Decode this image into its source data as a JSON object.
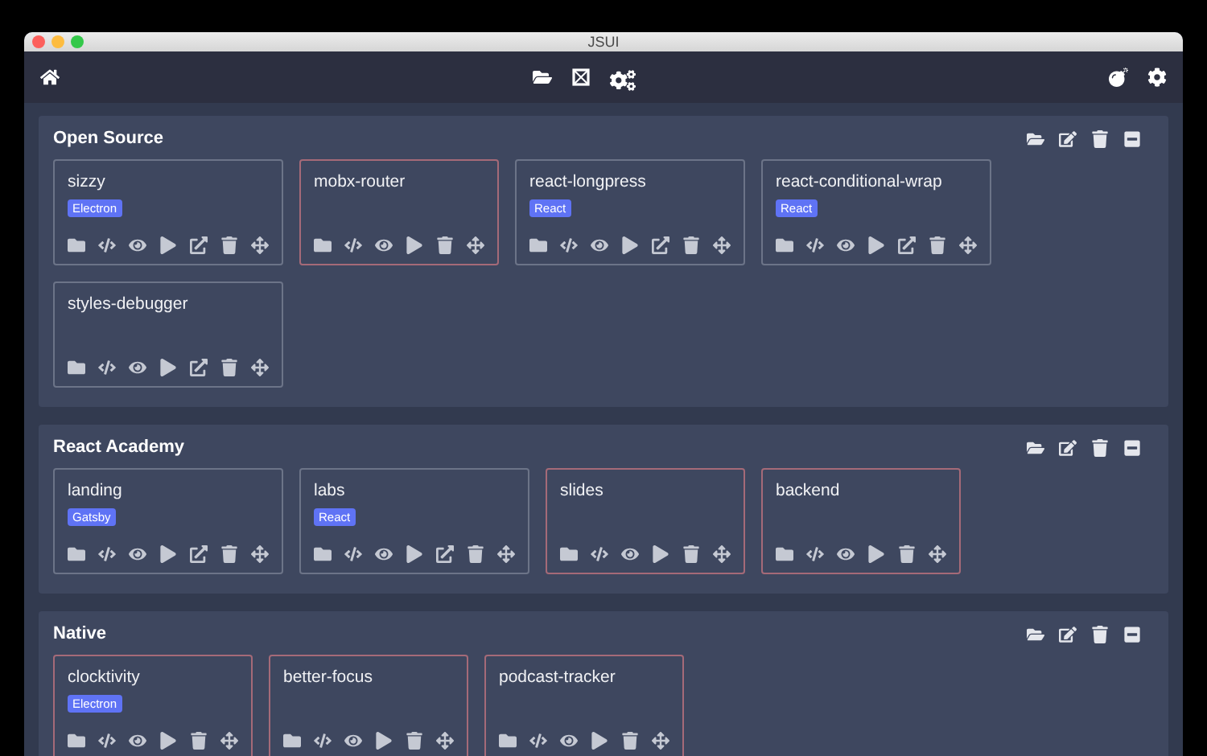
{
  "window": {
    "title": "JSUI"
  },
  "groups": [
    {
      "title": "Open Source",
      "projects": [
        {
          "name": "sizzy",
          "tag": "Electron",
          "flagged": false,
          "external_link": true
        },
        {
          "name": "mobx-router",
          "flagged": true,
          "external_link": false
        },
        {
          "name": "react-longpress",
          "tag": "React",
          "flagged": false,
          "external_link": true
        },
        {
          "name": "react-conditional-wrap",
          "tag": "React",
          "flagged": false,
          "external_link": true
        },
        {
          "name": "styles-debugger",
          "flagged": false,
          "external_link": true
        }
      ]
    },
    {
      "title": "React Academy",
      "projects": [
        {
          "name": "landing",
          "tag": "Gatsby",
          "flagged": false,
          "external_link": true
        },
        {
          "name": "labs",
          "tag": "React",
          "flagged": false,
          "external_link": true
        },
        {
          "name": "slides",
          "flagged": true,
          "external_link": false
        },
        {
          "name": "backend",
          "flagged": true,
          "external_link": false
        }
      ]
    },
    {
      "title": "Native",
      "projects": [
        {
          "name": "clocktivity",
          "tag": "Electron",
          "flagged": true,
          "external_link": false
        },
        {
          "name": "better-focus",
          "flagged": true,
          "external_link": false
        },
        {
          "name": "podcast-tracker",
          "flagged": true,
          "external_link": false
        }
      ]
    }
  ]
}
